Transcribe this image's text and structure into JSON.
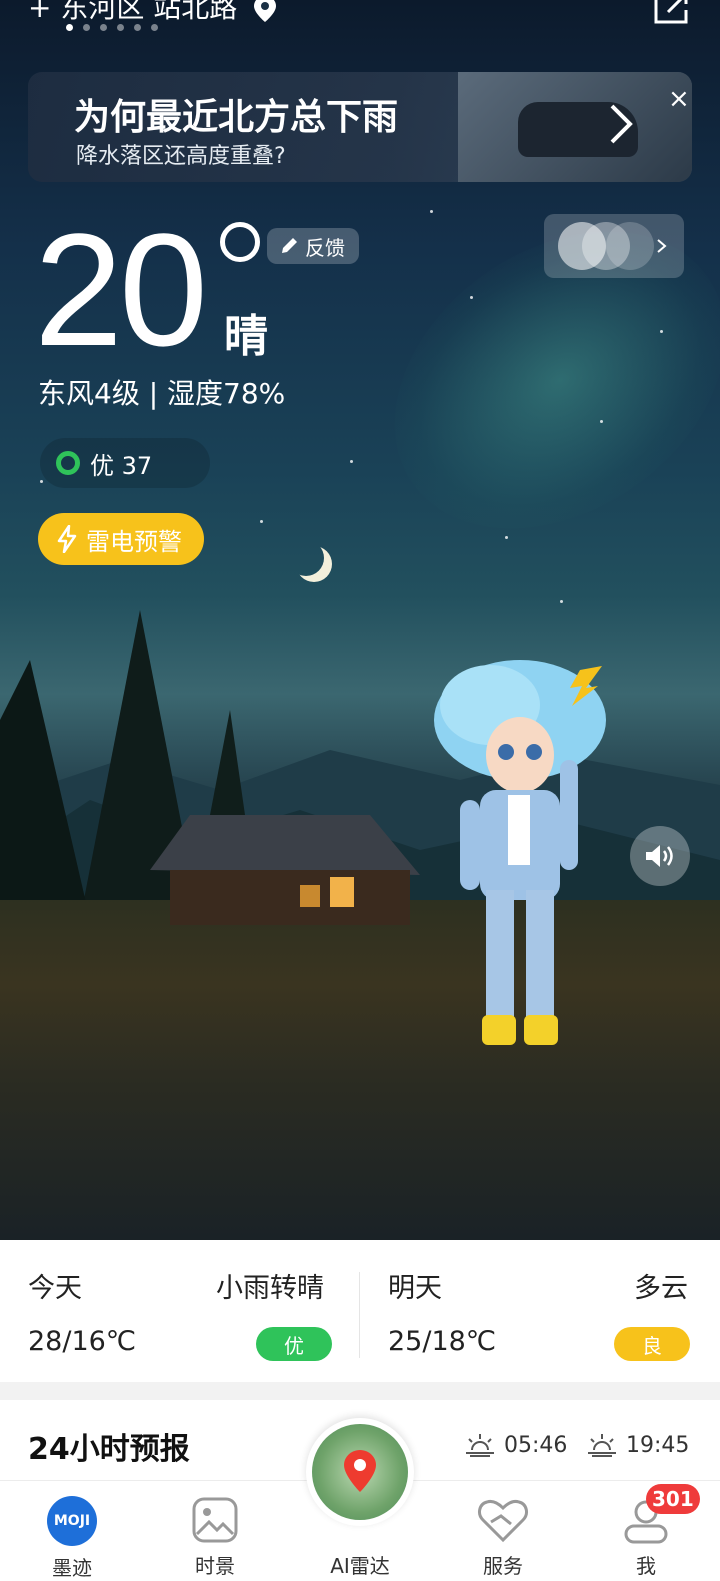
{
  "location": {
    "name": "东河区 站北路",
    "prefix_symbol": "+",
    "page_count": 6,
    "active_page": 1
  },
  "banner": {
    "title": "为何最近北方总下雨",
    "subtitle": "降水落区还高度重叠?",
    "close_glyph": "×"
  },
  "current": {
    "temperature": "20",
    "condition": "晴",
    "wind_humidity": "东风4级 | 湿度78%",
    "feedback_label": "反馈"
  },
  "aqi": {
    "label": "优 37",
    "color": "#2fc35a"
  },
  "alert": {
    "label": "雷电预警",
    "color": "#f7c21b"
  },
  "today": {
    "label": "今天",
    "condition": "小雨转晴",
    "temps": "28/16℃",
    "aqi_badge": "优",
    "badge_color": "#2fc35a"
  },
  "tomorrow": {
    "label": "明天",
    "condition": "多云",
    "temps": "25/18℃",
    "aqi_badge": "良",
    "badge_color": "#f7c21b"
  },
  "forecast": {
    "title": "24小时预报",
    "sunrise": "05:46",
    "sunset": "19:45"
  },
  "tabs": [
    {
      "label": "墨迹",
      "icon": "moji-logo-icon"
    },
    {
      "label": "时景",
      "icon": "image-icon"
    },
    {
      "label": "AI雷达",
      "icon": "radar-map-icon"
    },
    {
      "label": "服务",
      "icon": "heart-hands-icon"
    },
    {
      "label": "我",
      "icon": "user-icon"
    }
  ],
  "notification_count": "301",
  "accent": "#1e6fd9"
}
